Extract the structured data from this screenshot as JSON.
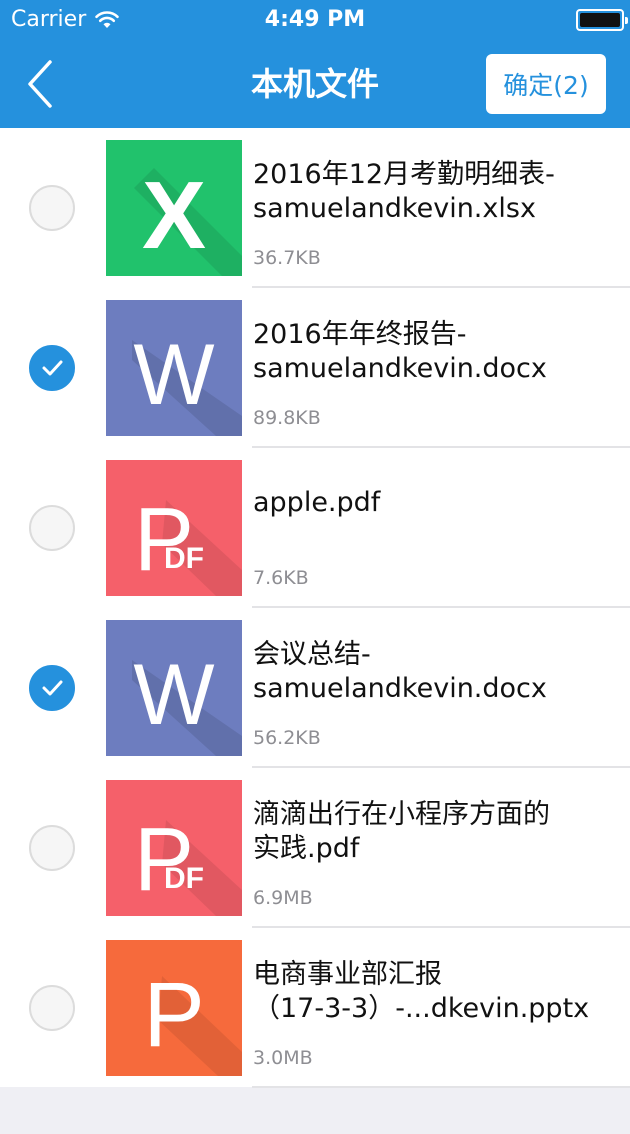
{
  "status_bar": {
    "carrier": "Carrier",
    "time": "4:49 PM"
  },
  "nav": {
    "title": "本机文件",
    "confirm_label": "确定(2)"
  },
  "colors": {
    "accent": "#2591dd",
    "excel": "#21c26c",
    "word": "#6d7dbf",
    "pdf": "#f5606a",
    "ppt": "#f66a3c"
  },
  "files": [
    {
      "name_line1": "2016年12月考勤明细表-",
      "name_line2": "samuelandkevin.xlsx",
      "size": "36.7KB",
      "type": "excel-icon",
      "checked": false
    },
    {
      "name_line1": "2016年年终报告-",
      "name_line2": "samuelandkevin.docx",
      "size": "89.8KB",
      "type": "word-icon",
      "checked": true
    },
    {
      "name_line1": "apple.pdf",
      "name_line2": "",
      "size": "7.6KB",
      "type": "pdf-icon",
      "checked": false
    },
    {
      "name_line1": "会议总结-",
      "name_line2": "samuelandkevin.docx",
      "size": "56.2KB",
      "type": "word-icon",
      "checked": true
    },
    {
      "name_line1": "滴滴出行在小程序方面的",
      "name_line2": "实践.pdf",
      "size": "6.9MB",
      "type": "pdf-icon",
      "checked": false
    },
    {
      "name_line1": "电商事业部汇报",
      "name_line2": "（17-3-3）-...dkevin.pptx",
      "size": "3.0MB",
      "type": "ppt-icon",
      "checked": false
    }
  ]
}
